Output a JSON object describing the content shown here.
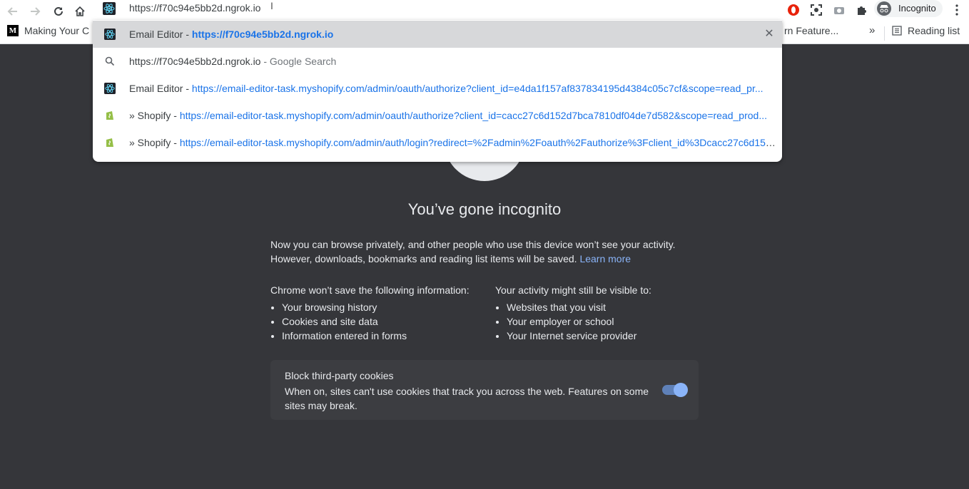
{
  "omnibox": {
    "typed_text": "https://f70c94e5bb2d.ngrok.io",
    "caret_glyph": "I"
  },
  "bookmarks": {
    "item1_icon_letter": "M",
    "item1_label": "Making Your C",
    "item2_label": "rn Feature...",
    "overflow_label": "»",
    "reading_list_label": "Reading list"
  },
  "profile": {
    "label": "Incognito"
  },
  "suggestions": [
    {
      "prefix": "Email Editor - ",
      "url": "https://f70c94e5bb2d.ngrok.io",
      "suffix": "",
      "icon": "react-icon"
    },
    {
      "prefix": "https://f70c94e5bb2d.ngrok.io",
      "url": "",
      "suffix": " - Google Search",
      "icon": "search-icon"
    },
    {
      "prefix": "Email Editor - ",
      "url": "https://email-editor-task.myshopify.com/admin/oauth/authorize?client_id=e4da1f157af837834195d4384c05c7cf&scope=read_pr...",
      "suffix": "",
      "icon": "react-icon"
    },
    {
      "prefix": "» Shopify - ",
      "url": "https://email-editor-task.myshopify.com/admin/oauth/authorize?client_id=cacc27c6d152d7bca7810df04de7d582&scope=read_prod...",
      "suffix": "",
      "icon": "shopify-icon"
    },
    {
      "prefix": "» Shopify - ",
      "url": "https://email-editor-task.myshopify.com/admin/auth/login?redirect=%2Fadmin%2Foauth%2Fauthorize%3Fclient_id%3Dcacc27c6d152...",
      "suffix": "",
      "icon": "shopify-icon"
    }
  ],
  "close_glyph": "✕",
  "incognito_page": {
    "heading": "You’ve gone incognito",
    "para_line1": "Now you can browse privately, and other people who use this device won’t see your activity.",
    "para_line2": "However, downloads, bookmarks and reading list items will be saved.",
    "learn_more": "Learn more",
    "left_col": {
      "title_a": "Chrome ",
      "title_b": "won’t save",
      "title_c": " the following information:",
      "items": [
        "Your browsing history",
        "Cookies and site data",
        "Information entered in forms"
      ]
    },
    "right_col": {
      "title_a": "Your activity ",
      "title_b": "might still be visible",
      "title_c": " to:",
      "items": [
        "Websites that you visit",
        "Your employer or school",
        "Your Internet service provider"
      ]
    },
    "cookie_card": {
      "title": "Block third-party cookies",
      "description": "When on, sites can't use cookies that track you across the web. Features on some sites may break.",
      "toggle_on": true
    }
  },
  "colors": {
    "page_bg": "#35363a",
    "link": "#8ab4f8",
    "url_blue": "#1a73e8"
  }
}
